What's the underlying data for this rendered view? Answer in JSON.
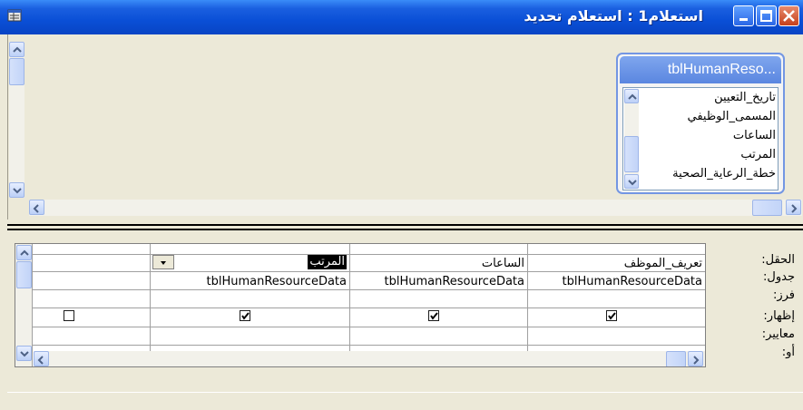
{
  "window": {
    "title": "استعلام1 : استعلام تحديد"
  },
  "table_box": {
    "title": "tblHumanReso...",
    "fields": [
      "تاريخ_التعيين",
      "المسمى_الوظيفي",
      "الساعات",
      "المرتب",
      "خطة_الرعاية_الصحية"
    ]
  },
  "grid": {
    "row_labels": [
      "الحقل:",
      "جدول:",
      "فرز:",
      "إظهار:",
      "معايير:",
      "أو:"
    ],
    "columns": [
      {
        "field": "تعريف_الموظف",
        "table": "tblHumanResourceData",
        "show": true
      },
      {
        "field": "الساعات",
        "table": "tblHumanResourceData",
        "show": true
      },
      {
        "field": "المرتب",
        "table": "tblHumanResourceData",
        "show": true
      },
      {
        "field": "",
        "table": "",
        "show": false
      }
    ]
  },
  "colors": {
    "title_bar": "#0a4fd6",
    "table_box_border": "#7396e3",
    "selection": "#000000"
  }
}
